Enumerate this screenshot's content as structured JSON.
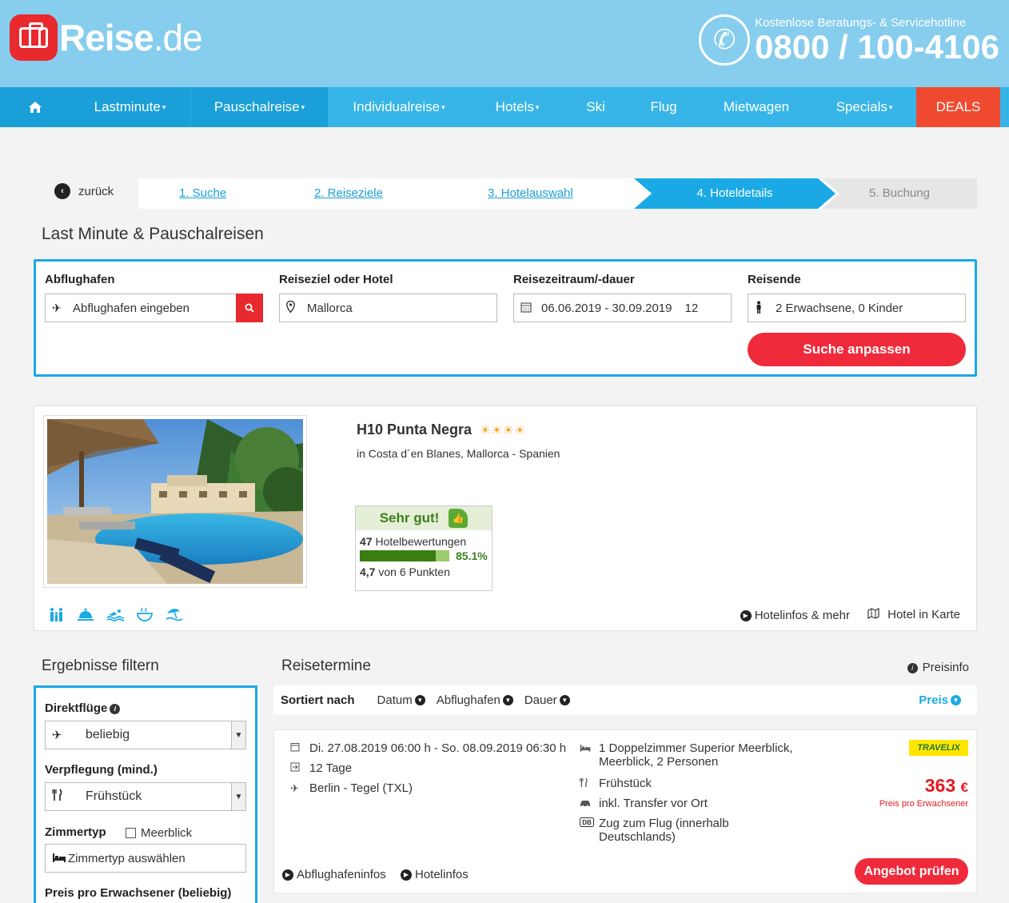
{
  "header": {
    "logo_main": "Reise",
    "logo_tld": ".de",
    "hotline_sub": "Kostenlose Beratungs- & Servicehotline",
    "hotline_number": "0800 / 100-4106"
  },
  "nav": {
    "items": [
      {
        "label": "Lastminute",
        "caret": "▾"
      },
      {
        "label": "Pauschalreise",
        "caret": "▾"
      },
      {
        "label": "Individualreise",
        "caret": "▾"
      },
      {
        "label": "Hotels",
        "caret": "▾"
      },
      {
        "label": "Ski",
        "caret": ""
      },
      {
        "label": "Flug",
        "caret": ""
      },
      {
        "label": "Mietwagen",
        "caret": ""
      },
      {
        "label": "Specials",
        "caret": "▾"
      },
      {
        "label": "DEALS",
        "caret": ""
      }
    ]
  },
  "steps": {
    "back": "zurück",
    "items": [
      "1. Suche",
      "2. Reiseziele",
      "3. Hotelauswahl",
      "4. Hoteldetails",
      "5. Buchung"
    ]
  },
  "page_title": "Last Minute & Pauschalreisen",
  "search": {
    "departure_label": "Abflughafen",
    "departure_placeholder": "Abflughafen eingeben",
    "destination_label": "Reiseziel oder Hotel",
    "destination_value": "Mallorca",
    "period_label": "Reisezeitraum/-dauer",
    "period_value": "06.06.2019 - 30.09.2019",
    "duration_value": "12",
    "travellers_label": "Reisende",
    "travellers_value": "2 Erwachsene, 0 Kinder",
    "submit": "Suche anpassen"
  },
  "hotel": {
    "name": "H10 Punta Negra",
    "stars": "☀☀☀☀",
    "location": "in Costa d´en Blanes, Mallorca - Spanien",
    "rating_label": "Sehr gut!",
    "reviews_count": "47",
    "reviews_label": "Hotelbewertungen",
    "recommend_pct": "85.1%",
    "recommend_fraction": 0.851,
    "score": "4,7",
    "score_suffix": "von 6 Punkten",
    "link_info": "Hotelinfos & mehr",
    "link_map": "Hotel in Karte"
  },
  "filter": {
    "title": "Ergebnisse filtern",
    "direct_label": "Direktflüge",
    "direct_value": "beliebig",
    "board_label": "Verpflegung (mind.)",
    "board_value": "Frühstück",
    "room_label": "Zimmertyp",
    "seaview_label": "Meerblick",
    "room_placeholder": "Zimmertyp auswählen",
    "price_label": "Preis pro Erwachsener (beliebig)"
  },
  "results": {
    "title": "Reisetermine",
    "price_info": "Preisinfo",
    "sorted_by": "Sortiert nach",
    "sort_options": [
      "Datum",
      "Abflughafen",
      "Dauer"
    ],
    "sort_price": "Preis",
    "offer": {
      "dates": "Di. 27.08.2019 06:00 h - So. 08.09.2019 06:30 h",
      "duration": "12 Tage",
      "airport": "Berlin - Tegel (TXL)",
      "room_line1": "1 Doppelzimmer Superior Meerblick,",
      "room_line2": "Meerblick, 2 Personen",
      "board": "Frühstück",
      "transfer": "inkl. Transfer vor Ort",
      "train_line1": "Zug zum Flug (innerhalb",
      "train_line2": "Deutschlands)",
      "operator": "TRAVELIX",
      "price": "363",
      "currency": "€",
      "price_sub": "Preis pro Erwachsener",
      "button": "Angebot prüfen",
      "link_airport": "Abflughafeninfos",
      "link_hotel": "Hotelinfos"
    }
  }
}
